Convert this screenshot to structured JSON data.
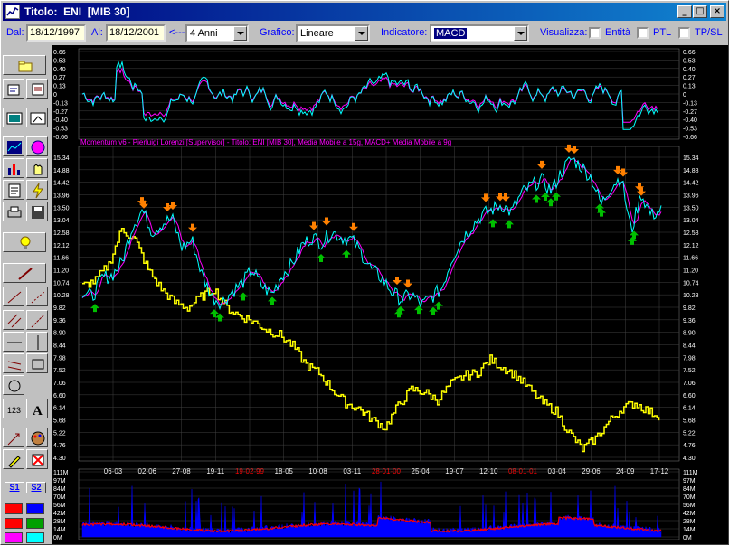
{
  "window": {
    "title": "Titolo:  ENI  [MIB 30]"
  },
  "toolbar": {
    "dal_label": "Dal:",
    "dal_value": "18/12/1997",
    "al_label": "Al:",
    "al_value": "18/12/2001",
    "nav_back": "<---",
    "period_value": "4 Anni",
    "grafico_label": "Grafico:",
    "grafico_value": "Lineare",
    "indicatore_label": "Indicatore:",
    "indicatore_value": "MACD",
    "visualizza_label": "Visualizza:",
    "entita_label": "Entità",
    "ptl_label": "PTL",
    "tpsl_label": "TP/SL"
  },
  "sidebar": {
    "s1_label": "S1",
    "s2_label": "S2",
    "icons": [
      "folder-icon",
      "open-file-icon",
      "save-file-icon",
      "image-icon",
      "export-image-icon",
      "line-chart-icon",
      "globe-icon",
      "bar-chart-icon",
      "hand-icon",
      "notes-icon",
      "lightning-icon",
      "print-icon",
      "disk-icon",
      "lightbulb-icon",
      "trendline-icon",
      "line-icon",
      "dashed-line-icon",
      "parallel-icon",
      "diagonal-icon",
      "horizontal-line-icon",
      "vertical-line-icon",
      "channel-icon",
      "rectangle-icon",
      "circle-icon",
      "numbers-icon",
      "text-icon",
      "arrow-icon",
      "palette-icon",
      "pen-icon",
      "delete-icon"
    ],
    "swatches": [
      "#ff0000",
      "#0000ff",
      "#ff0000",
      "#00a000",
      "#ff00ff",
      "#00ffff"
    ]
  },
  "chart_data": [
    {
      "type": "line",
      "name_panel": "macd-panel",
      "y_ticks": [
        "0.66",
        "0.53",
        "0.40",
        "0.27",
        "0.13",
        "0",
        "-0.13",
        "-0.27",
        "-0.40",
        "-0.53",
        "-0.66"
      ],
      "ylim": [
        -0.66,
        0.66
      ],
      "series_colors": [
        "#00ffff",
        "#ff00ff"
      ]
    },
    {
      "type": "line",
      "name_panel": "price-panel",
      "legend": "Momentum v6 - Pierluigi Lorenzi [Supervisor] - Titolo: ENI [MIB 30],  Media Mobile a 15g,  MACD+ Media Mobile a 9g",
      "y_ticks": [
        "15.34",
        "14.88",
        "14.42",
        "13.96",
        "13.50",
        "13.04",
        "12.58",
        "12.12",
        "11.66",
        "11.20",
        "10.74",
        "10.28",
        "9.82",
        "9.36",
        "8.90",
        "8.44",
        "7.98",
        "7.52",
        "7.06",
        "6.60",
        "6.14",
        "5.68",
        "5.22",
        "4.76",
        "4.30"
      ],
      "ylim": [
        4.3,
        15.34
      ],
      "x_ticks": [
        {
          "label": "06-03",
          "color": "#ffffff"
        },
        {
          "label": "02-06",
          "color": "#ffffff"
        },
        {
          "label": "27-08",
          "color": "#ffffff"
        },
        {
          "label": "19-11",
          "color": "#ffffff"
        },
        {
          "label": "19-02-99",
          "color": "#ff0000"
        },
        {
          "label": "18-05",
          "color": "#ffffff"
        },
        {
          "label": "10-08",
          "color": "#ffffff"
        },
        {
          "label": "03-11",
          "color": "#ffffff"
        },
        {
          "label": "28-01-00",
          "color": "#ff0000"
        },
        {
          "label": "25-04",
          "color": "#ffffff"
        },
        {
          "label": "19-07",
          "color": "#ffffff"
        },
        {
          "label": "12-10",
          "color": "#ffffff"
        },
        {
          "label": "08-01-01",
          "color": "#ff0000"
        },
        {
          "label": "03-04",
          "color": "#ffffff"
        },
        {
          "label": "29-06",
          "color": "#ffffff"
        },
        {
          "label": "24-09",
          "color": "#ffffff"
        },
        {
          "label": "17-12",
          "color": "#ffffff"
        }
      ],
      "price_keypoints": [
        10.4,
        10.2,
        10.9,
        11.0,
        11.5,
        12.8,
        13.4,
        12.6,
        12.9,
        13.1,
        12.0,
        12.3,
        11.0,
        10.2,
        10.0,
        10.4,
        10.7,
        11.2,
        10.6,
        10.3,
        11.0,
        11.4,
        12.1,
        12.4,
        12.2,
        12.6,
        12.4,
        12.3,
        11.8,
        11.2,
        10.9,
        10.4,
        10.1,
        10.3,
        9.9,
        10.2,
        10.5,
        11.6,
        12.3,
        12.8,
        13.2,
        13.4,
        13.6,
        13.3,
        14.0,
        14.3,
        14.5,
        14.1,
        14.8,
        15.3,
        15.0,
        14.6,
        13.6,
        14.3,
        14.6,
        12.6,
        14.0,
        13.2,
        13.4
      ],
      "yellow_keypoints": [
        10.6,
        10.8,
        11.4,
        12.7,
        12.3,
        11.2,
        10.5,
        10.0,
        9.8,
        10.2,
        10.5,
        9.8,
        9.5,
        9.3,
        9.0,
        8.8,
        8.4,
        7.7,
        7.4,
        6.8,
        6.3,
        6.1,
        5.7,
        5.4,
        6.2,
        6.8,
        6.7,
        6.4,
        7.0,
        7.3,
        7.4,
        7.9,
        7.6,
        7.3,
        6.8,
        6.3,
        6.0,
        5.2,
        4.6,
        5.0,
        5.6,
        6.1,
        6.3,
        6.0,
        5.8
      ],
      "series_colors": [
        "#00ffff",
        "#ff00ff",
        "#ffff00"
      ],
      "buy_signal_color": "#00c000",
      "sell_signal_color": "#ff8000"
    },
    {
      "type": "bar",
      "name_panel": "volume-panel",
      "y_ticks": [
        "111M",
        "97M",
        "84M",
        "70M",
        "56M",
        "42M",
        "28M",
        "14M",
        "0M"
      ],
      "ylim": [
        0,
        111
      ],
      "series_colors": [
        "#0000ff",
        "#ff0000"
      ]
    }
  ]
}
